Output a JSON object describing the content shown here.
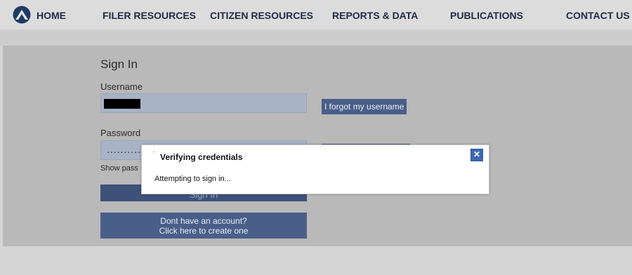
{
  "nav": {
    "items": [
      "HOME",
      "FILER RESOURCES",
      "CITIZEN RESOURCES",
      "REPORTS & DATA",
      "PUBLICATIONS",
      "CONTACT US"
    ]
  },
  "signin": {
    "title": "Sign In",
    "username_label": "Username",
    "forgot_username": "I forgot my username",
    "password_label": "Password",
    "password_mask": "..........",
    "show_password": "Show pass",
    "signin_button": "Sign In",
    "create_line1": "Dont have an account?",
    "create_line2": "Click here to create one"
  },
  "modal": {
    "title": "Verifying credentials",
    "message": "Attempting to sign in...",
    "close_glyph": "✕"
  },
  "colors": {
    "accent": "#4a5f88",
    "close": "#3c67b3"
  }
}
